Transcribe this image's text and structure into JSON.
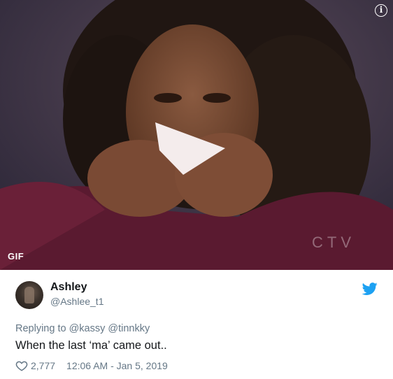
{
  "media": {
    "badge": "GIF",
    "watermark": "CTV",
    "info_icon": "info-icon"
  },
  "tweet": {
    "display_name": "Ashley",
    "handle": "@Ashlee_t1",
    "replying_to": "Replying to @kassy @tinnkky",
    "text": "When the last ‘ma’ came out..",
    "likes": "2,777",
    "timestamp": "12:06 AM - Jan 5, 2019",
    "brand_icon": "twitter-bird-icon",
    "like_icon": "heart-icon"
  },
  "colors": {
    "twitter_blue": "#1da1f2",
    "secondary_text": "#657786",
    "primary_text": "#14171a"
  }
}
